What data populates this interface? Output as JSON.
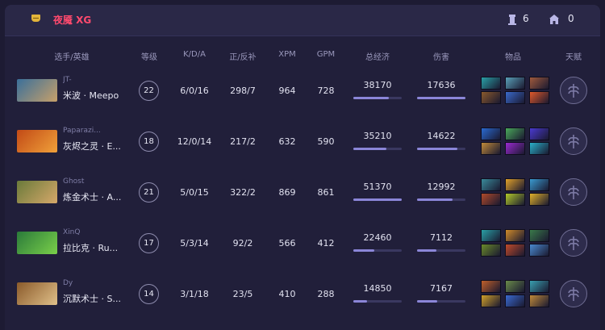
{
  "header": {
    "team_name": "夜魇 XG",
    "towers": "6",
    "barracks": "0"
  },
  "columns": {
    "player_hero": "选手/英雄",
    "level": "等级",
    "kda": "K/D/A",
    "lh_dn": "正/反补",
    "xpm": "XPM",
    "gpm": "GPM",
    "networth": "总经济",
    "damage": "伤害",
    "items": "物品",
    "talent": "天赋"
  },
  "players": [
    {
      "player": "JT-",
      "hero": "米波 · Meepo",
      "level": "22",
      "kda": "6/0/16",
      "lh_dn": "298/7",
      "xpm": "964",
      "gpm": "728",
      "networth": "38170",
      "networth_pct": 0.74,
      "damage": "17636",
      "damage_pct": 1.0,
      "hero_colors": [
        "#3a6f9a",
        "#c7a06a"
      ],
      "item_colors": [
        "#2aa0a6",
        "#5aa0b8",
        "#a05a3c",
        "#8a5a2c",
        "#3a6acb",
        "#e0592a"
      ]
    },
    {
      "player": "Paparazi...",
      "hero": "灰烬之灵 · E...",
      "level": "18",
      "kda": "12/0/14",
      "lh_dn": "217/2",
      "xpm": "632",
      "gpm": "590",
      "networth": "35210",
      "networth_pct": 0.69,
      "damage": "14622",
      "damage_pct": 0.83,
      "hero_colors": [
        "#c24a16",
        "#f0a13a"
      ],
      "item_colors": [
        "#2a6ad0",
        "#4aa85a",
        "#4a3ad0",
        "#c08a3a",
        "#9a2ad0",
        "#2ab0c8"
      ]
    },
    {
      "player": "Ghost",
      "hero": "炼金术士 · A...",
      "level": "21",
      "kda": "5/0/15",
      "lh_dn": "322/2",
      "xpm": "869",
      "gpm": "861",
      "networth": "51370",
      "networth_pct": 1.0,
      "damage": "12992",
      "damage_pct": 0.74,
      "hero_colors": [
        "#6a7a3a",
        "#d6a86a"
      ],
      "item_colors": [
        "#3a8a9a",
        "#e0a02a",
        "#3a9ad0",
        "#b04a2a",
        "#b0c82a",
        "#e0b02a"
      ]
    },
    {
      "player": "XinQ",
      "hero": "拉比克 · Ru...",
      "level": "17",
      "kda": "5/3/14",
      "lh_dn": "92/2",
      "xpm": "566",
      "gpm": "412",
      "networth": "22460",
      "networth_pct": 0.44,
      "damage": "7112",
      "damage_pct": 0.4,
      "hero_colors": [
        "#2a7a3a",
        "#7ad04a"
      ],
      "item_colors": [
        "#2aa0a6",
        "#d08a2a",
        "#3a7a4a",
        "#6a8a2a",
        "#c04a2a",
        "#4a8ad0"
      ]
    },
    {
      "player": "Dy",
      "hero": "沉默术士 · S...",
      "level": "14",
      "kda": "3/1/18",
      "lh_dn": "23/5",
      "xpm": "410",
      "gpm": "288",
      "networth": "14850",
      "networth_pct": 0.29,
      "damage": "7167",
      "damage_pct": 0.41,
      "hero_colors": [
        "#8a5a2a",
        "#e0c08a"
      ],
      "item_colors": [
        "#c0602a",
        "#6a8a4a",
        "#3aa0b0",
        "#d0a02a",
        "#3a6ad0",
        "#c08a3a"
      ]
    }
  ]
}
